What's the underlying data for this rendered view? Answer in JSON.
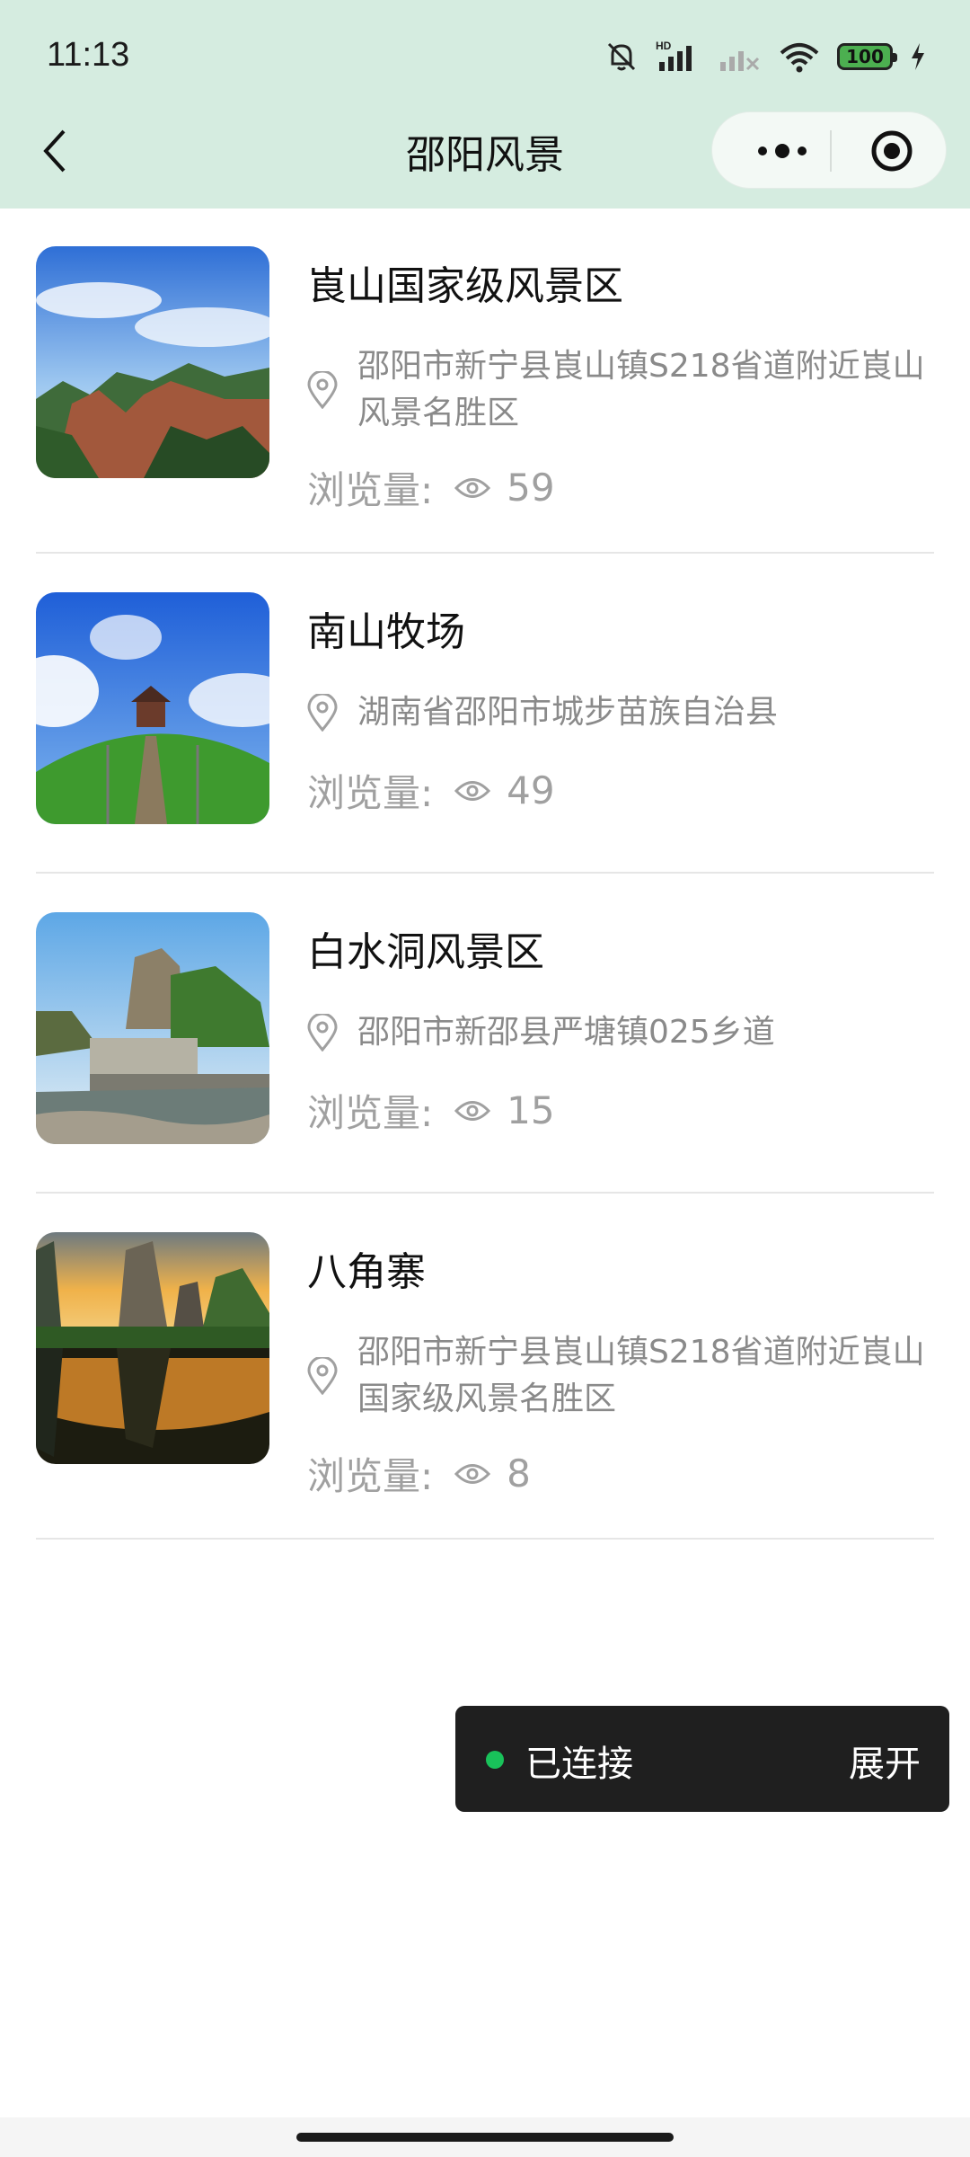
{
  "status_bar": {
    "time": "11:13",
    "network_label": "HD",
    "battery": "100",
    "icons": [
      "bell-off-icon",
      "signal-icon",
      "no-signal-icon",
      "wifi-icon",
      "battery-icon",
      "charging-icon"
    ]
  },
  "nav": {
    "title": "邵阳风景",
    "back_icon": "chevron-left-icon",
    "more_icon": "more-dots-icon",
    "target_icon": "target-icon"
  },
  "list": {
    "views_label": "浏览量:",
    "items": [
      {
        "title": "崀山国家级风景区",
        "address": "邵阳市新宁县崀山镇S218省道附近崀山风景名胜区",
        "views": "59"
      },
      {
        "title": "南山牧场",
        "address": "湖南省邵阳市城步苗族自治县",
        "views": "49"
      },
      {
        "title": "白水洞风景区",
        "address": "邵阳市新邵县严塘镇025乡道",
        "views": "15"
      },
      {
        "title": "八角寨",
        "address": "邵阳市新宁县崀山镇S218省道附近崀山国家级风景名胜区",
        "views": "8"
      }
    ]
  },
  "toast": {
    "status": "已连接",
    "expand": "展开",
    "dot_color": "#19c25a"
  },
  "colors": {
    "header_bg": "#d5ece0",
    "muted_text": "#8a8a8a"
  }
}
